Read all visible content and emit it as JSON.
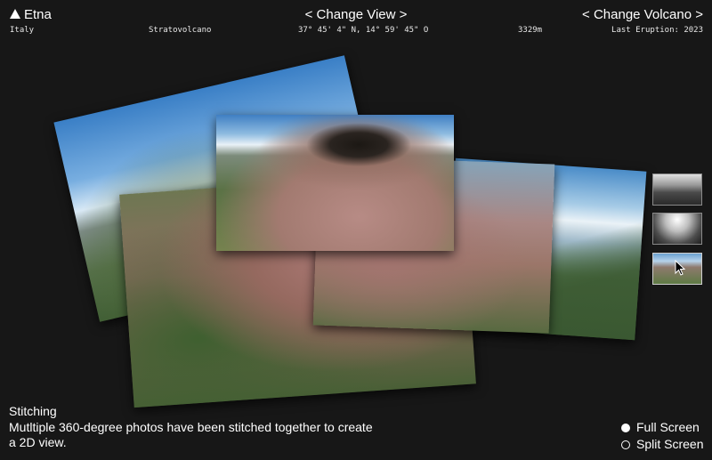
{
  "header": {
    "volcano_name": "Etna",
    "change_view_label": "< Change View >",
    "change_volcano_label": "< Change Volcano >"
  },
  "meta": {
    "country": "Italy",
    "type": "Stratovolcano",
    "coordinates": "37° 45' 4\" N, 14° 59' 45\" O",
    "elevation": "3329m",
    "last_eruption": "Last Eruption: 2023"
  },
  "thumbnails": [
    {
      "label": "grayscale-landscape"
    },
    {
      "label": "grayscale-sky"
    },
    {
      "label": "color-aerial",
      "selected": true
    }
  ],
  "caption": {
    "title": "Stitching",
    "body": "Mutltiple 360-degree photos have been stitched together to create a 2D view."
  },
  "view_options": {
    "full_screen": "Full Screen",
    "split_screen": "Split Screen",
    "selected": "Full Screen"
  },
  "colors": {
    "background": "#171717",
    "text": "#ffffff"
  }
}
